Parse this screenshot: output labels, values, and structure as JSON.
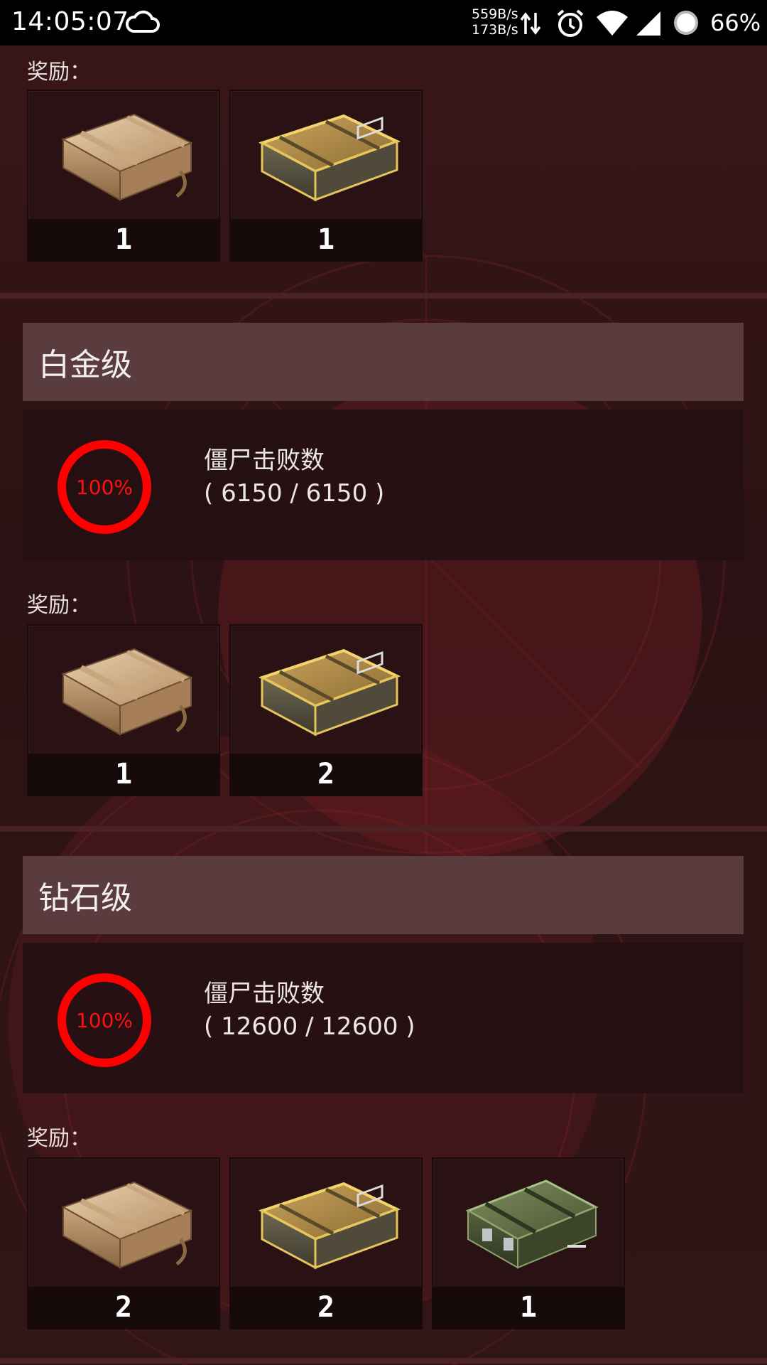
{
  "status_bar": {
    "time": "14:05:07",
    "net_up": "559B/s",
    "net_down": "173B/s",
    "battery": "66%",
    "icons": [
      "cloud-icon",
      "data-arrows-icon",
      "alarm-icon",
      "wifi-icon",
      "signal-icon",
      "battery-icon"
    ]
  },
  "sections": [
    {
      "rewards_label": "奖励：",
      "rewards": [
        {
          "item": "wooden-crate",
          "count": "1"
        },
        {
          "item": "gold-crate",
          "count": "1"
        }
      ]
    },
    {
      "tier": "白金级",
      "goal_name": "僵尸击败数",
      "percent_text": "100%",
      "percent": 1.0,
      "progress_text": "( 6150 / 6150 )",
      "rewards_label": "奖励：",
      "rewards": [
        {
          "item": "wooden-crate",
          "count": "1"
        },
        {
          "item": "gold-crate",
          "count": "2"
        }
      ]
    },
    {
      "tier": "钻石级",
      "goal_name": "僵尸击败数",
      "percent_text": "100%",
      "percent": 1.0,
      "progress_text": "( 12600 / 12600 )",
      "rewards_label": "奖励：",
      "rewards": [
        {
          "item": "wooden-crate",
          "count": "2"
        },
        {
          "item": "gold-crate",
          "count": "2"
        },
        {
          "item": "military-crate",
          "count": "1"
        }
      ]
    }
  ],
  "colors": {
    "progress_ring": "#ff0000",
    "tier_header_bg": "#5a3c3e",
    "panel_bg": "#241012"
  }
}
